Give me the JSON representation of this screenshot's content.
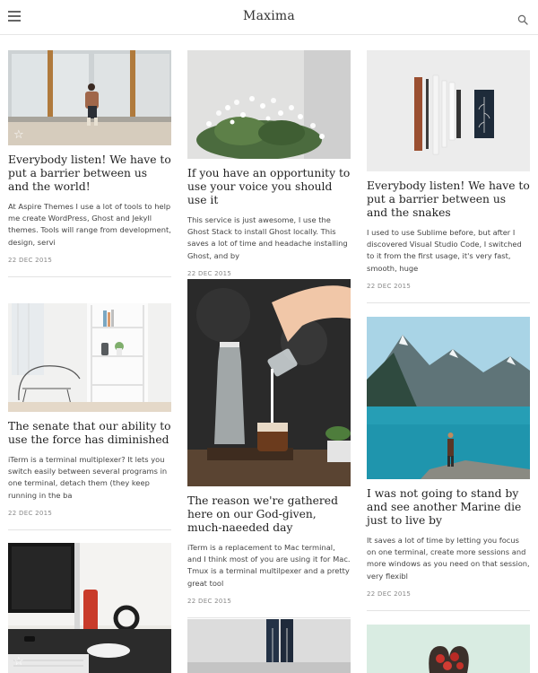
{
  "site": {
    "title": "Maxima"
  },
  "header": {
    "menu_icon": "hamburger-menu-icon",
    "search_icon": "search-icon"
  },
  "colors": {
    "text": "#222222",
    "muted": "#888888",
    "divider": "#e3e3e3"
  },
  "posts": [
    {
      "title": "Everybody listen! We have to put a barrier between us and the world!",
      "excerpt": "At Aspire Themes I use a lot of tools to help me create WordPress, Ghost and Jekyll themes. Tools will range from development, design, servi",
      "date": "22 DEC 2015",
      "featured": true,
      "image": "man-sitting-by-window"
    },
    {
      "title": "If you have an opportunity to use your voice you should use it",
      "excerpt": "This service is just awesome, I use the Ghost Stack to install Ghost locally. This saves a lot of time and headache installing Ghost, and by",
      "date": "22 DEC 2015",
      "featured": false,
      "image": "white-flowers"
    },
    {
      "title": "Everybody listen! We have to put a barrier between us and the snakes",
      "excerpt": "I used to use Sublime before, but after I discovered Visual Studio Code, I switched to it from the first usage, it's very fast, smooth, huge",
      "date": "22 DEC 2015",
      "featured": false,
      "image": "pens-and-ruler"
    },
    {
      "title": "The senate that our ability to use the force has diminished",
      "excerpt": "iTerm is a terminal multiplexer? It lets you switch easily between several programs in one terminal, detach them (they keep running in the ba",
      "date": "22 DEC 2015",
      "featured": false,
      "image": "white-room-chair"
    },
    {
      "title": "The reason we're gathered here on our God-given, much-naeeded day",
      "excerpt": "iTerm is a replacement to Mac terminal, and I think most of you are using it for Mac. Tmux is a terminal multilpexer and a pretty great tool",
      "date": "22 DEC 2015",
      "featured": false,
      "image": "pouring-milk"
    },
    {
      "title": "I was not going to stand by and see another Marine die just to live by",
      "excerpt": "It saves a lot of time by letting you focus on one terminal, create more sessions and more windows as you need on that session, very flexibl",
      "date": "22 DEC 2015",
      "featured": false,
      "image": "mountain-lake"
    },
    {
      "featured": true,
      "image": "desk-workspace"
    },
    {
      "featured": false,
      "image": "books-on-shelf"
    },
    {
      "featured": false,
      "image": "strawberries-heart"
    }
  ]
}
